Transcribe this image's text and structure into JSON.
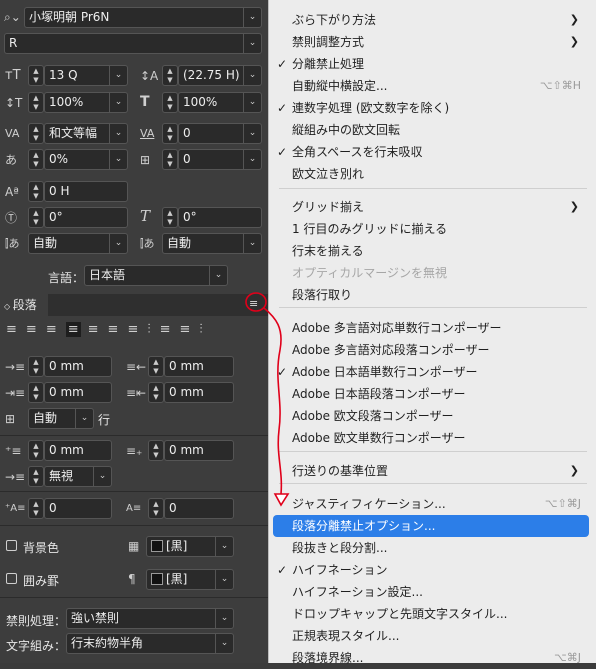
{
  "character": {
    "font_family": "小塚明朝 Pr6N",
    "font_style": "R",
    "font_size": "13 Q",
    "leading": "(22.75 H)",
    "vertical_scale": "100%",
    "horizontal_scale": "100%",
    "kerning": "和文等幅",
    "tracking": "0",
    "tsume": "0%",
    "grid": "0",
    "baseline_shift": "0 H",
    "skew": "0°",
    "rotation": "0°",
    "aki_before": "自動",
    "aki_after": "自動",
    "language_label": "言語：",
    "language": "日本語"
  },
  "paragraph": {
    "tab_label": "段落",
    "left_indent": "0 mm",
    "right_indent": "0 mm",
    "first_line_indent": "0 mm",
    "last_line_indent": "0 mm",
    "grid_lines": "自動",
    "lines_suffix": "行",
    "space_before": "0 mm",
    "space_after": "0 mm",
    "drop_cap_style": "無視",
    "drop_cap_lines": "0",
    "drop_cap_chars": "0",
    "shading_label": "背景色",
    "shading_color": "[黒]",
    "border_label": "囲み罫",
    "border_color": "[黒]",
    "kinsoku_label": "禁則処理：",
    "kinsoku_value": "強い禁則",
    "mojikumi_label": "文字組み：",
    "mojikumi_value": "行末約物半角"
  },
  "menu": {
    "items": [
      {
        "label": "ぶら下がり方法",
        "checked": false,
        "shortcut": "",
        "submenu": true,
        "disabled": false
      },
      {
        "label": "禁則調整方式",
        "checked": false,
        "shortcut": "",
        "submenu": true,
        "disabled": false
      },
      {
        "label": "分離禁止処理",
        "checked": true,
        "shortcut": "",
        "submenu": false,
        "disabled": false
      },
      {
        "label": "自動縦中横設定...",
        "checked": false,
        "shortcut": "⌥⇧⌘H",
        "submenu": false,
        "disabled": false
      },
      {
        "label": "連数字処理 (欧文数字を除く)",
        "checked": true,
        "shortcut": "",
        "submenu": false,
        "disabled": false
      },
      {
        "label": "縦組み中の欧文回転",
        "checked": false,
        "shortcut": "",
        "submenu": false,
        "disabled": false
      },
      {
        "label": "全角スペースを行末吸収",
        "checked": true,
        "shortcut": "",
        "submenu": false,
        "disabled": false
      },
      {
        "label": "欧文泣き別れ",
        "checked": false,
        "shortcut": "",
        "submenu": false,
        "disabled": false
      },
      {
        "label": "グリッド揃え",
        "checked": false,
        "shortcut": "",
        "submenu": true,
        "disabled": false
      },
      {
        "label": "1 行目のみグリッドに揃える",
        "checked": false,
        "shortcut": "",
        "submenu": false,
        "disabled": false
      },
      {
        "label": "行末を揃える",
        "checked": false,
        "shortcut": "",
        "submenu": false,
        "disabled": false
      },
      {
        "label": "オプティカルマージンを無視",
        "checked": false,
        "shortcut": "",
        "submenu": false,
        "disabled": true
      },
      {
        "label": "段落行取り",
        "checked": false,
        "shortcut": "",
        "submenu": false,
        "disabled": false
      },
      {
        "label": "Adobe 多言語対応単数行コンポーザー",
        "checked": false,
        "shortcut": "",
        "submenu": false,
        "disabled": false
      },
      {
        "label": "Adobe 多言語対応段落コンポーザー",
        "checked": false,
        "shortcut": "",
        "submenu": false,
        "disabled": false
      },
      {
        "label": "Adobe 日本語単数行コンポーザー",
        "checked": true,
        "shortcut": "",
        "submenu": false,
        "disabled": false
      },
      {
        "label": "Adobe 日本語段落コンポーザー",
        "checked": false,
        "shortcut": "",
        "submenu": false,
        "disabled": false
      },
      {
        "label": "Adobe 欧文段落コンポーザー",
        "checked": false,
        "shortcut": "",
        "submenu": false,
        "disabled": false
      },
      {
        "label": "Adobe 欧文単数行コンポーザー",
        "checked": false,
        "shortcut": "",
        "submenu": false,
        "disabled": false
      },
      {
        "label": "行送りの基準位置",
        "checked": false,
        "shortcut": "",
        "submenu": true,
        "disabled": false
      },
      {
        "label": "ジャスティフィケーション...",
        "checked": false,
        "shortcut": "⌥⇧⌘J",
        "submenu": false,
        "disabled": false
      },
      {
        "label": "段落分離禁止オプション...",
        "checked": false,
        "shortcut": "",
        "submenu": false,
        "disabled": false,
        "highlighted": true
      },
      {
        "label": "段抜きと段分割...",
        "checked": false,
        "shortcut": "",
        "submenu": false,
        "disabled": false
      },
      {
        "label": "ハイフネーション",
        "checked": true,
        "shortcut": "",
        "submenu": false,
        "disabled": false
      },
      {
        "label": "ハイフネーション設定...",
        "checked": false,
        "shortcut": "",
        "submenu": false,
        "disabled": false
      },
      {
        "label": "ドロップキャップと先頭文字スタイル...",
        "checked": false,
        "shortcut": "",
        "submenu": false,
        "disabled": false
      },
      {
        "label": "正規表現スタイル...",
        "checked": false,
        "shortcut": "",
        "submenu": false,
        "disabled": false
      },
      {
        "label": "段落境界線...",
        "checked": false,
        "shortcut": "⌥⌘J",
        "submenu": false,
        "disabled": false
      }
    ]
  },
  "colors": {
    "highlight": "#2c7ee8",
    "annotation": "#e0001a"
  }
}
